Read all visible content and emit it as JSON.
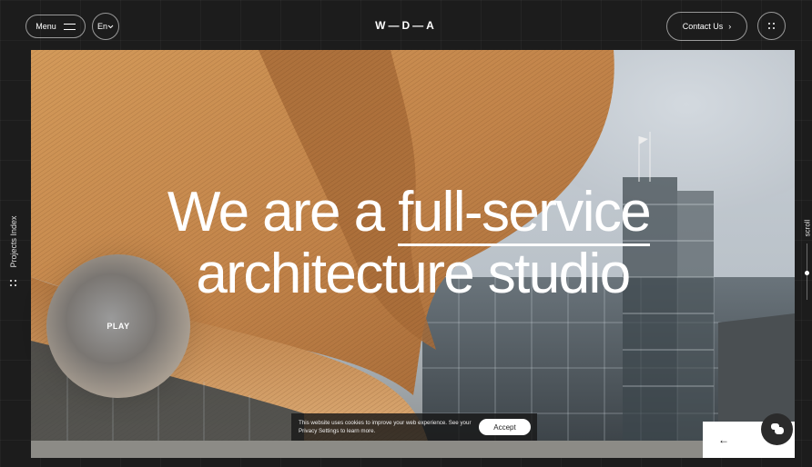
{
  "header": {
    "menu_label": "Menu",
    "lang_label": "En",
    "logo": "W—D—A",
    "contact_label": "Contact Us",
    "contact_arrow": "›"
  },
  "hero": {
    "headline_part1": "We are a ",
    "headline_underlined": "full-service",
    "headline_line2": "architecture studio",
    "play_label": "PLAY"
  },
  "sidebar": {
    "projects_index": "Projects Index",
    "scroll_label": "scroll"
  },
  "cookie": {
    "text": "This website uses cookies to improve your web experience. See your Privacy Settings to learn more.",
    "accept_label": "Accept"
  },
  "nav": {
    "back_arrow": "←"
  },
  "colors": {
    "background": "#1c1c1c",
    "wood": "#c98a4a",
    "sky": "#c1c8cf"
  },
  "icons": [
    "hamburger-icon",
    "chevron-down-icon",
    "grid-dots-icon",
    "arrow-left-icon",
    "chat-icon"
  ]
}
